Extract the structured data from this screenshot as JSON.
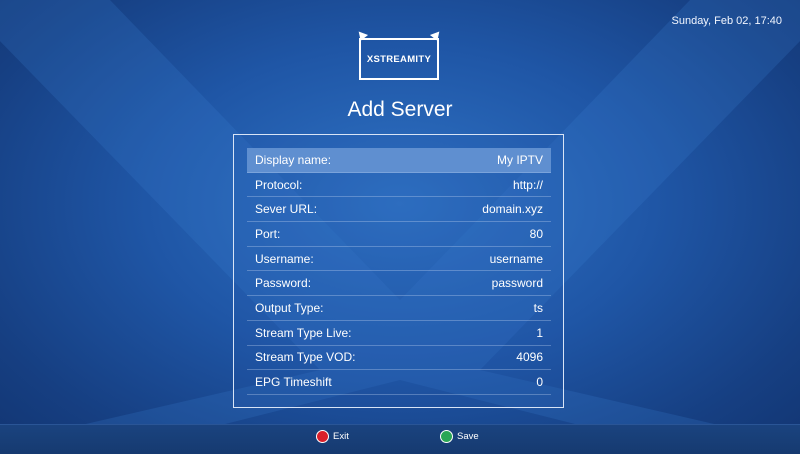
{
  "clock": "Sunday, Feb 02, 17:40",
  "logo_text": "XSTREAMITY",
  "page_title": "Add Server",
  "fields": [
    {
      "label": "Display name:",
      "value": "My IPTV"
    },
    {
      "label": "Protocol:",
      "value": "http://"
    },
    {
      "label": "Sever URL:",
      "value": "domain.xyz"
    },
    {
      "label": "Port:",
      "value": "80"
    },
    {
      "label": "Username:",
      "value": "username"
    },
    {
      "label": "Password:",
      "value": "password"
    },
    {
      "label": "Output Type:",
      "value": "ts"
    },
    {
      "label": "Stream Type Live:",
      "value": "1"
    },
    {
      "label": "Stream Type VOD:",
      "value": "4096"
    },
    {
      "label": "EPG Timeshift",
      "value": "0"
    }
  ],
  "buttons": {
    "exit": {
      "label": "Exit",
      "color": "#d91f2a",
      "icon": "red-circle-icon"
    },
    "save": {
      "label": "Save",
      "color": "#2aa655",
      "icon": "green-circle-icon"
    }
  },
  "colors": {
    "background": "#1f56a6",
    "selected_row": "#5f8fd0"
  }
}
